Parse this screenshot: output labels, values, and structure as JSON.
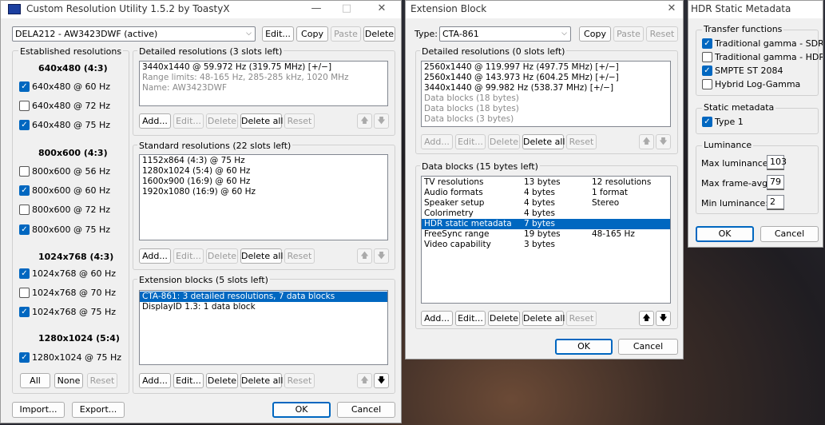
{
  "cru": {
    "title": "Custom Resolution Utility 1.5.2 by ToastyX",
    "monitor_select": "DELA212 - AW3423DWF (active)",
    "top_buttons": {
      "edit": "Edit...",
      "copy": "Copy",
      "paste": "Paste",
      "delete": "Delete"
    },
    "established": {
      "label": "Established resolutions",
      "groups": [
        {
          "header": "640x480 (4:3)",
          "items": [
            {
              "label": "640x480 @ 60 Hz",
              "checked": true
            },
            {
              "label": "640x480 @ 72 Hz",
              "checked": false
            },
            {
              "label": "640x480 @ 75 Hz",
              "checked": true
            }
          ]
        },
        {
          "header": "800x600 (4:3)",
          "items": [
            {
              "label": "800x600 @ 56 Hz",
              "checked": false
            },
            {
              "label": "800x600 @ 60 Hz",
              "checked": true
            },
            {
              "label": "800x600 @ 72 Hz",
              "checked": false
            },
            {
              "label": "800x600 @ 75 Hz",
              "checked": true
            }
          ]
        },
        {
          "header": "1024x768 (4:3)",
          "items": [
            {
              "label": "1024x768 @ 60 Hz",
              "checked": true
            },
            {
              "label": "1024x768 @ 70 Hz",
              "checked": false
            },
            {
              "label": "1024x768 @ 75 Hz",
              "checked": true
            }
          ]
        },
        {
          "header": "1280x1024 (5:4)",
          "items": [
            {
              "label": "1280x1024 @ 75 Hz",
              "checked": true
            }
          ]
        }
      ],
      "all": "All",
      "none": "None",
      "reset": "Reset"
    },
    "detailed": {
      "label": "Detailed resolutions (3 slots left)",
      "rows": [
        {
          "text": "3440x1440 @ 59.972 Hz (319.75 MHz) [+/−]",
          "dim": false
        },
        {
          "text": "Range limits: 48-165 Hz, 285-285 kHz, 1020 MHz",
          "dim": true
        },
        {
          "text": "Name: AW3423DWF",
          "dim": true
        }
      ]
    },
    "standard": {
      "label": "Standard resolutions (22 slots left)",
      "rows": [
        "1152x864 (4:3) @ 75 Hz",
        "1280x1024 (5:4) @ 60 Hz",
        "1600x900 (16:9) @ 60 Hz",
        "1920x1080 (16:9) @ 60 Hz"
      ]
    },
    "extension": {
      "label": "Extension blocks (5 slots left)",
      "rows": [
        "CTA-861: 3 detailed resolutions, 7 data blocks",
        "DisplayID 1.3: 1 data block"
      ]
    },
    "list_buttons": {
      "add": "Add...",
      "edit": "Edit...",
      "delete": "Delete",
      "delete_all": "Delete all",
      "reset": "Reset"
    },
    "import": "Import...",
    "export": "Export...",
    "ok": "OK",
    "cancel": "Cancel"
  },
  "ext": {
    "title": "Extension Block",
    "type_label": "Type:",
    "type_value": "CTA-861",
    "copy": "Copy",
    "paste": "Paste",
    "reset": "Reset",
    "detailed": {
      "label": "Detailed resolutions (0 slots left)",
      "rows": [
        {
          "text": "2560x1440 @ 119.997 Hz (497.75 MHz) [+/−]",
          "dim": false
        },
        {
          "text": "2560x1440 @ 143.973 Hz (604.25 MHz) [+/−]",
          "dim": false
        },
        {
          "text": "3440x1440 @ 99.982 Hz (538.37 MHz) [+/−]",
          "dim": false
        },
        {
          "text": "Data blocks (18 bytes)",
          "dim": true
        },
        {
          "text": "Data blocks (18 bytes)",
          "dim": true
        },
        {
          "text": "Data blocks (3 bytes)",
          "dim": true
        }
      ]
    },
    "datablocks": {
      "label": "Data blocks (15 bytes left)",
      "rows": [
        {
          "name": "TV resolutions",
          "size": "13 bytes",
          "info": "12 resolutions"
        },
        {
          "name": "Audio formats",
          "size": "4 bytes",
          "info": "1 format"
        },
        {
          "name": "Speaker setup",
          "size": "4 bytes",
          "info": "Stereo"
        },
        {
          "name": "Colorimetry",
          "size": "4 bytes",
          "info": ""
        },
        {
          "name": "HDR static metadata",
          "size": "7 bytes",
          "info": ""
        },
        {
          "name": "FreeSync range",
          "size": "19 bytes",
          "info": "48-165 Hz"
        },
        {
          "name": "Video capability",
          "size": "3 bytes",
          "info": ""
        }
      ]
    },
    "list_buttons": {
      "add": "Add...",
      "edit": "Edit...",
      "delete": "Delete",
      "delete_all": "Delete all",
      "reset": "Reset"
    },
    "ok": "OK",
    "cancel": "Cancel"
  },
  "hdr": {
    "title": "HDR Static Metadata",
    "transfer_label": "Transfer functions",
    "transfer": [
      {
        "label": "Traditional gamma - SDR",
        "checked": true
      },
      {
        "label": "Traditional gamma - HDR",
        "checked": false
      },
      {
        "label": "SMPTE ST 2084",
        "checked": true
      },
      {
        "label": "Hybrid Log-Gamma",
        "checked": false
      }
    ],
    "static_label": "Static metadata",
    "static": [
      {
        "label": "Type 1",
        "checked": true
      }
    ],
    "luminance_label": "Luminance",
    "max_lum_label": "Max luminance:",
    "max_lum": "103",
    "max_frame_label": "Max frame-avg:",
    "max_frame": "79",
    "min_lum_label": "Min luminance:",
    "min_lum": "2",
    "ok": "OK",
    "cancel": "Cancel"
  },
  "colors": {
    "accent": "#0067c0",
    "window_bg": "#f0f0f0"
  }
}
